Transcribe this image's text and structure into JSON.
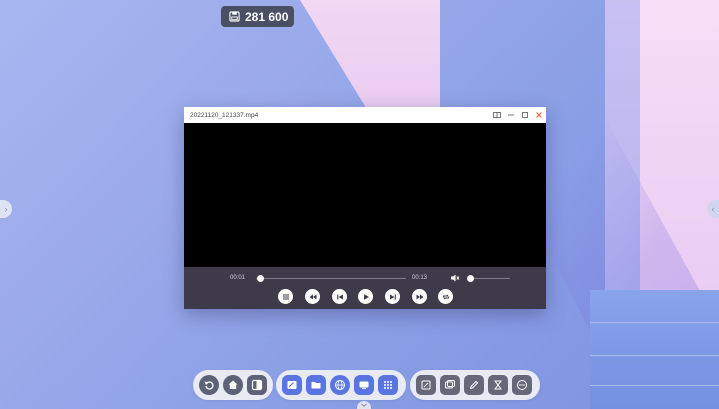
{
  "counter": {
    "icon": "save-counter-icon",
    "value": "281 600"
  },
  "player": {
    "filename": "20221120_121337.mp4",
    "window_buttons": [
      "fit-window-icon",
      "minimize-icon",
      "maximize-icon",
      "close-icon"
    ],
    "current_time": "00:01",
    "duration": "00:13",
    "progress_fraction": 0.03,
    "volume_fraction": 0.05,
    "muted": true,
    "controls": [
      "playlist-icon",
      "rewind-icon",
      "previous-icon",
      "play-icon",
      "next-icon",
      "fast-forward-icon",
      "repeat-icon"
    ]
  },
  "dock": {
    "group1": [
      "back-icon",
      "home-icon",
      "windows-icon"
    ],
    "group2": [
      "whiteboard-icon",
      "folder-icon",
      "browser-icon",
      "screen-share-icon",
      "apps-icon"
    ],
    "group3": [
      "annotate-icon",
      "screenshot-icon",
      "pen-icon",
      "timer-icon",
      "more-icon"
    ]
  },
  "colors": {
    "control_bar": "#3e3a49",
    "dock_bg": "#e9ebf4",
    "dock_button": "#5d6276",
    "accent_blue": "#5a74e0",
    "close": "#e4572e"
  }
}
